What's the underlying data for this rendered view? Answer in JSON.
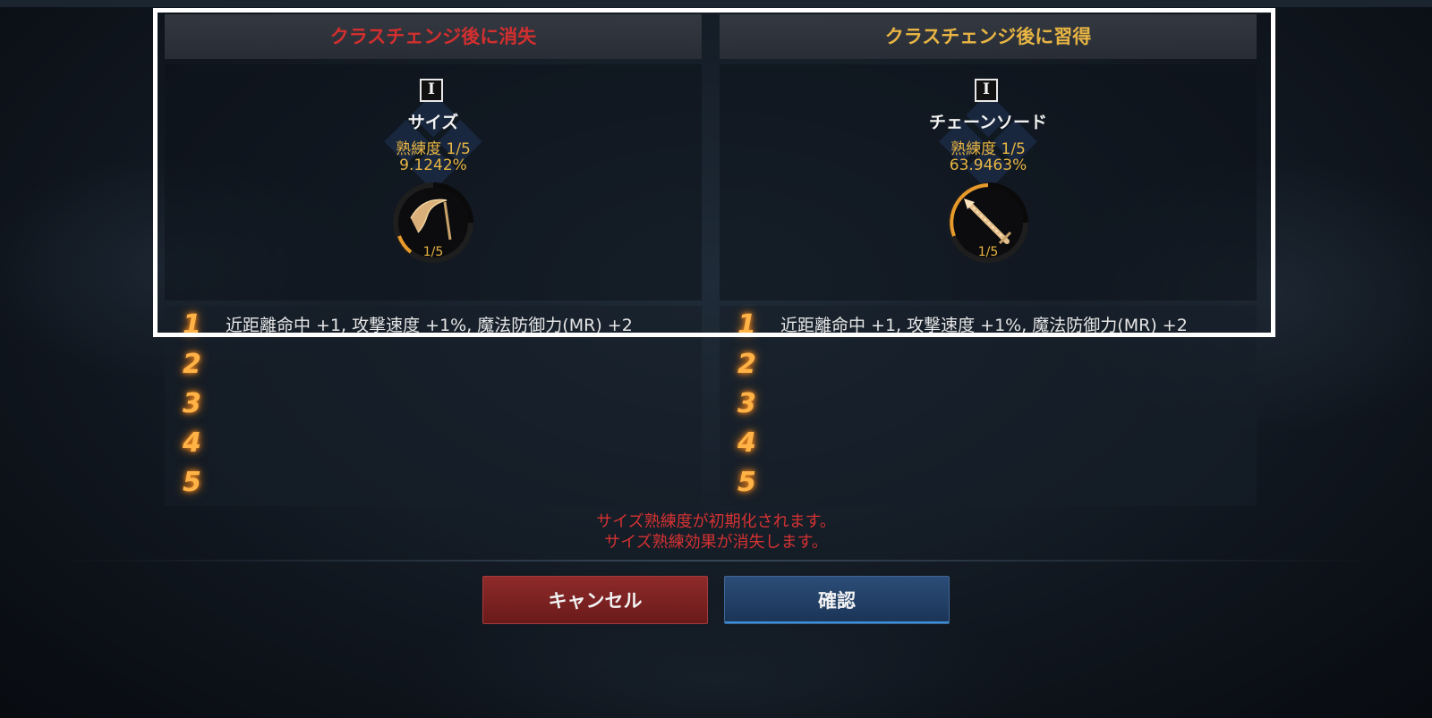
{
  "panels": {
    "left": {
      "header": "クラスチェンジ後に消失",
      "tier": "I",
      "skill_name": "サイズ",
      "mastery_level": "熟練度 1/5",
      "mastery_percent": "9.1242%",
      "ring_label": "1/5",
      "weapon_icon": "scythe-icon",
      "effects": [
        {
          "num": "1",
          "text": "近距離命中 +1, 攻撃速度 +1%, 魔法防御力(MR) +2"
        },
        {
          "num": "2",
          "text": ""
        },
        {
          "num": "3",
          "text": ""
        },
        {
          "num": "4",
          "text": ""
        },
        {
          "num": "5",
          "text": ""
        }
      ]
    },
    "right": {
      "header": "クラスチェンジ後に習得",
      "tier": "I",
      "skill_name": "チェーンソード",
      "mastery_level": "熟練度 1/5",
      "mastery_percent": "63.9463%",
      "ring_label": "1/5",
      "weapon_icon": "chain-sword-icon",
      "effects": [
        {
          "num": "1",
          "text": "近距離命中 +1, 攻撃速度 +1%, 魔法防御力(MR) +2"
        },
        {
          "num": "2",
          "text": ""
        },
        {
          "num": "3",
          "text": ""
        },
        {
          "num": "4",
          "text": ""
        },
        {
          "num": "5",
          "text": ""
        }
      ]
    }
  },
  "warnings": {
    "line1": "サイズ熟練度が初期化されます。",
    "line2": "サイズ熟練効果が消失します。"
  },
  "buttons": {
    "cancel": "キャンセル",
    "confirm": "確認"
  },
  "colors": {
    "lost": "#d32f2f",
    "gain": "#e8b543",
    "warning": "#d33232"
  }
}
